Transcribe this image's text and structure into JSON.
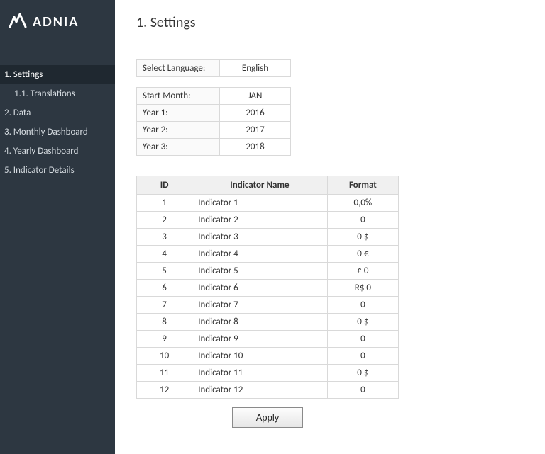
{
  "brand_name": "ADNIA",
  "page_title": "1. Settings",
  "nav": [
    {
      "label": "1. Settings",
      "active": true,
      "sub": false
    },
    {
      "label": "1.1. Translations",
      "active": false,
      "sub": true
    },
    {
      "label": "2. Data",
      "active": false,
      "sub": false
    },
    {
      "label": "3. Monthly Dashboard",
      "active": false,
      "sub": false
    },
    {
      "label": "4. Yearly Dashboard",
      "active": false,
      "sub": false
    },
    {
      "label": "5. Indicator Details",
      "active": false,
      "sub": false
    }
  ],
  "lang": {
    "label": "Select Language:",
    "value": "English"
  },
  "period": {
    "start_month_label": "Start Month:",
    "start_month_value": "JAN",
    "year1_label": "Year 1:",
    "year1_value": "2016",
    "year2_label": "Year 2:",
    "year2_value": "2017",
    "year3_label": "Year 3:",
    "year3_value": "2018"
  },
  "indicators": {
    "headers": {
      "id": "ID",
      "name": "Indicator Name",
      "format": "Format"
    },
    "rows": [
      {
        "id": "1",
        "name": "Indicator 1",
        "format": "0,0%"
      },
      {
        "id": "2",
        "name": "Indicator 2",
        "format": "0"
      },
      {
        "id": "3",
        "name": "Indicator 3",
        "format": "0 $"
      },
      {
        "id": "4",
        "name": "Indicator 4",
        "format": "0 €"
      },
      {
        "id": "5",
        "name": "Indicator 5",
        "format": "£ 0"
      },
      {
        "id": "6",
        "name": "Indicator 6",
        "format": "R$ 0"
      },
      {
        "id": "7",
        "name": "Indicator 7",
        "format": "0"
      },
      {
        "id": "8",
        "name": "Indicator 8",
        "format": "0 $"
      },
      {
        "id": "9",
        "name": "Indicator 9",
        "format": "0"
      },
      {
        "id": "10",
        "name": "Indicator 10",
        "format": "0"
      },
      {
        "id": "11",
        "name": "Indicator 11",
        "format": "0 $"
      },
      {
        "id": "12",
        "name": "Indicator 12",
        "format": "0"
      }
    ]
  },
  "apply_label": "Apply"
}
